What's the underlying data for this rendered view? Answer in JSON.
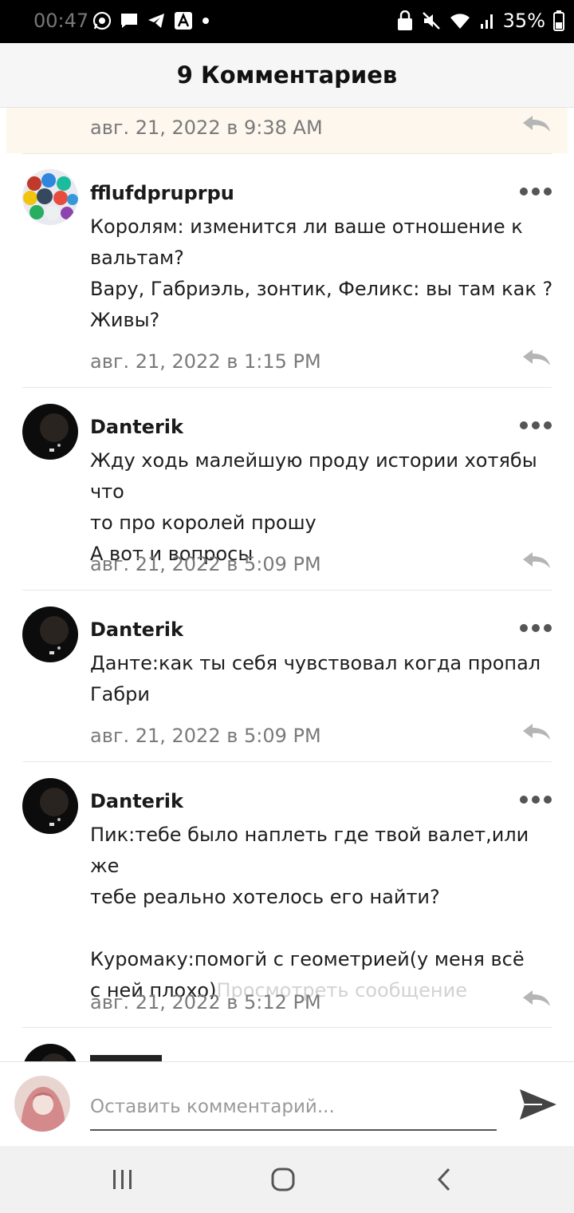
{
  "status_bar": {
    "time": "00:47",
    "left_icons": [
      "whatsapp-icon",
      "message-icon",
      "telegram-icon",
      "font-app-icon",
      "dot-icon"
    ],
    "right_icons": [
      "lock-icon",
      "mute-icon",
      "wifi-icon",
      "signal-icon",
      "battery-icon"
    ],
    "battery": "35%"
  },
  "header": {
    "title": "9 Комментариев"
  },
  "partial_comment": {
    "timestamp": "авг. 21, 2022 в 9:38 AM"
  },
  "comments": [
    {
      "author": "fflufdpruprpu",
      "lines": [
        "Королям: изменится ли ваше отношение к",
        "вальтам?",
        "Вару, Габриэль, зонтик, Феликс: вы там как ?",
        "Живы?"
      ],
      "timestamp": "авг. 21, 2022 в 1:15 PM"
    },
    {
      "author": "Danterik",
      "lines": [
        "Жду ходь малейшую проду истории хотябы что",
        "то про королей прошу",
        "А вот и вопросы"
      ],
      "timestamp": "авг. 21, 2022 в 5:09 PM"
    },
    {
      "author": "Danterik",
      "lines": [
        "Данте:как ты себя чувствовал когда пропал",
        "Габри"
      ],
      "timestamp": "авг. 21, 2022 в 5:09 PM"
    },
    {
      "author": "Danterik",
      "lines": [
        "Пик:тебе было наплеть где твой валет,или же",
        "тебе реально хотелось его найти?",
        "",
        "Куромаку:помогй с геометрией(у меня всё",
        "с ней плохо)"
      ],
      "view_message": "Просмотреть сообщение",
      "timestamp": "авг. 21, 2022 в 5:12 PM"
    }
  ],
  "compose": {
    "placeholder": "Оставить комментарий..."
  },
  "nav": {
    "buttons": [
      "recent-apps-icon",
      "home-icon",
      "back-icon"
    ]
  },
  "colors": {
    "accent_partial_bg": "#fdf7ee",
    "timestamp": "#7a7a7a",
    "link_faded": "#d2d2d2"
  }
}
